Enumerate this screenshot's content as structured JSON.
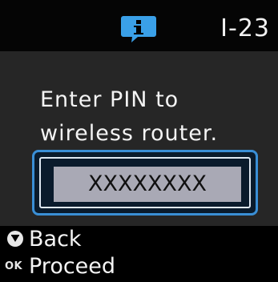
{
  "header": {
    "icon": "info-icon",
    "screen_code": "I-23"
  },
  "message": {
    "line1": "Enter PIN to",
    "line2": "wireless router."
  },
  "pin": {
    "value": "XXXXXXXX"
  },
  "footer": {
    "back_icon": "stop-back-icon",
    "back_label": "Back",
    "ok_badge": "OK",
    "ok_label": "Proceed"
  },
  "colors": {
    "accent_frame": "#3a8fd6",
    "info_icon": "#3aa0e8",
    "field_bg": "#a9a9b5"
  }
}
